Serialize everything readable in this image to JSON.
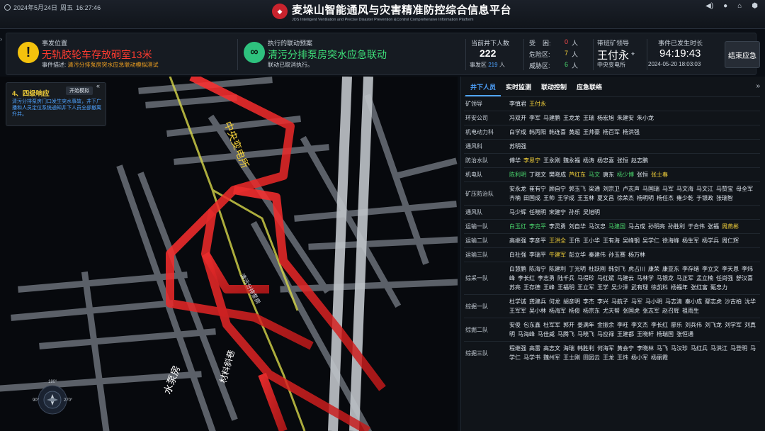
{
  "topbar": {
    "date": "2024年5月24日",
    "weekday": "周五",
    "time": "16:27:46",
    "title": "麦垛山智能通风与灾害精准防控综合信息平台",
    "subtitle": "JDS Intelligent Ventilation and Precise Disaster Prevention &Control Comprehensive Information Platform",
    "icons": [
      "speaker-icon",
      "user-icon",
      "home-icon",
      "cube-icon"
    ]
  },
  "incident": {
    "location_label": "事发位置",
    "location": "无轨胶轮车存放硐室13米",
    "desc_label": "事件描述:",
    "desc": "清污分排泵房突水应急联动模拟测试",
    "plan_label": "执行的联动预案",
    "plan": "清污分排泵房突水应急联动",
    "plan_status": "联动已取消执行。",
    "people_label": "当前井下人数",
    "people_count": "222",
    "area_label": "事发区",
    "area_count": "219",
    "area_unit": "人",
    "trapped_label": "受    困:",
    "trapped": "0",
    "danger_label": "危险区:",
    "danger": "7",
    "threat_label": "威胁区:",
    "threat": "6",
    "unit": "人",
    "leader_label": "带班矿领导",
    "leader": "王付永",
    "leader_loc": "中央变电所",
    "duration_label": "事件已发生时长",
    "duration": "94:19:43",
    "start_time": "2024-05-20 18:03:03",
    "end_button": "结束应急"
  },
  "response": {
    "title": "4、四级响应",
    "sim_button": "开始模拟",
    "text": "清污分排泵房门口发生突水事故，井下广播和人员定位系统通知井下人员全部撤离升井。"
  },
  "compass": {
    "n": "180°",
    "w": "90°",
    "e": "270°"
  },
  "map_labels": [
    "中央变电所",
    "清污分排泵房",
    "水泵房",
    "材料斜巷"
  ],
  "panel": {
    "tabs": [
      "井下人员",
      "实时监测",
      "联动控制",
      "应急联络"
    ],
    "roster": [
      {
        "team": "矿领导",
        "people": [
          [
            "李慎君",
            ""
          ],
          [
            "王付永",
            "yellow"
          ]
        ]
      },
      {
        "team": "环安公司",
        "people": [
          [
            "冯双开",
            ""
          ],
          [
            "李军",
            ""
          ],
          [
            "马建鹏",
            ""
          ],
          [
            "王龙龙",
            ""
          ],
          [
            "王瑞",
            ""
          ],
          [
            "杨宏旭",
            ""
          ],
          [
            "朱建安",
            ""
          ],
          [
            "朱小龙",
            ""
          ]
        ]
      },
      {
        "team": "机电动力科",
        "people": [
          [
            "白学成",
            ""
          ],
          [
            "韩丙阳",
            ""
          ],
          [
            "韩连喜",
            ""
          ],
          [
            "黄超",
            ""
          ],
          [
            "王帅豪",
            ""
          ],
          [
            "杨百军",
            ""
          ],
          [
            "杨洪强",
            ""
          ]
        ]
      },
      {
        "team": "通风科",
        "people": [
          [
            "苏明强",
            ""
          ]
        ]
      },
      {
        "team": "防治水队",
        "people": [
          [
            "傅华",
            ""
          ],
          [
            "李思宁",
            "yellow"
          ],
          [
            "王永刚",
            ""
          ],
          [
            "魏永福",
            ""
          ],
          [
            "杨涛",
            ""
          ],
          [
            "杨忠喜",
            ""
          ],
          [
            "张恒",
            ""
          ],
          [
            "赵志鹏",
            ""
          ]
        ]
      },
      {
        "team": "机电队",
        "people": [
          [
            "陈利明",
            "green"
          ],
          [
            "丁晓文",
            ""
          ],
          [
            "樊晓成",
            ""
          ],
          [
            "芦红东",
            "yellow"
          ],
          [
            "马文",
            "green"
          ],
          [
            "唐东",
            ""
          ],
          [
            "杨少博",
            "green"
          ],
          [
            "张恒",
            ""
          ],
          [
            "张士春",
            "yellow"
          ]
        ]
      },
      {
        "team": "矿压防治队",
        "people": [
          [
            "安永龙",
            ""
          ],
          [
            "崔有宁",
            ""
          ],
          [
            "顾自宁",
            ""
          ],
          [
            "郭玉飞",
            ""
          ],
          [
            "梁通",
            ""
          ],
          [
            "刘宗卫",
            ""
          ],
          [
            "卢志声",
            ""
          ],
          [
            "马国瑞",
            ""
          ],
          [
            "马军",
            ""
          ],
          [
            "马文海",
            ""
          ],
          [
            "马文江",
            ""
          ],
          [
            "马赞宝",
            ""
          ],
          [
            "母全军",
            ""
          ],
          [
            "齐楠",
            ""
          ],
          [
            "田国成",
            ""
          ],
          [
            "王帅",
            ""
          ],
          [
            "王学成",
            ""
          ],
          [
            "王玉林",
            ""
          ],
          [
            "夏文昌",
            ""
          ],
          [
            "徐荣杰",
            ""
          ],
          [
            "杨明明",
            ""
          ],
          [
            "杨任杰",
            ""
          ],
          [
            "雍少乾",
            ""
          ],
          [
            "于银政",
            ""
          ],
          [
            "张瑞智",
            ""
          ]
        ]
      },
      {
        "team": "通风队",
        "people": [
          [
            "马少辉",
            ""
          ],
          [
            "任晓明",
            ""
          ],
          [
            "宋建宁",
            ""
          ],
          [
            "孙乐",
            ""
          ],
          [
            "吴旭明",
            ""
          ]
        ]
      },
      {
        "team": "运输一队",
        "people": [
          [
            "白玉红",
            "green"
          ],
          [
            "李克平",
            "green"
          ],
          [
            "李灵勇",
            ""
          ],
          [
            "刘自华",
            ""
          ],
          [
            "马汉忠",
            ""
          ],
          [
            "马建国",
            "green"
          ],
          [
            "马占成",
            ""
          ],
          [
            "孙明亮",
            ""
          ],
          [
            "孙胜利",
            ""
          ],
          [
            "于合伟",
            ""
          ],
          [
            "张福",
            ""
          ],
          [
            "周燕彬",
            "yellow"
          ]
        ]
      },
      {
        "team": "运输二队",
        "people": [
          [
            "高继强",
            ""
          ],
          [
            "李彦平",
            ""
          ],
          [
            "王洪全",
            "yellow"
          ],
          [
            "王伟",
            ""
          ],
          [
            "王小华",
            ""
          ],
          [
            "王有海",
            ""
          ],
          [
            "吴峰钢",
            ""
          ],
          [
            "吴学仁",
            ""
          ],
          [
            "徐海峰",
            ""
          ],
          [
            "杨生军",
            ""
          ],
          [
            "杨学兵",
            ""
          ],
          [
            "周仁辉",
            ""
          ]
        ]
      },
      {
        "team": "运输三队",
        "people": [
          [
            "白社强",
            ""
          ],
          [
            "李瑞平",
            ""
          ],
          [
            "牛建军",
            "yellow"
          ],
          [
            "彭立华",
            ""
          ],
          [
            "秦建伟",
            ""
          ],
          [
            "孙玉赛",
            ""
          ],
          [
            "杨万林",
            ""
          ]
        ]
      },
      {
        "team": "综采一队",
        "people": [
          [
            "白慧鹏",
            ""
          ],
          [
            "陈海宁",
            ""
          ],
          [
            "陈建利",
            ""
          ],
          [
            "丁光明",
            ""
          ],
          [
            "杜跃刚",
            ""
          ],
          [
            "韩剑飞",
            ""
          ],
          [
            "虎占川",
            ""
          ],
          [
            "康荣",
            ""
          ],
          [
            "康亚东",
            ""
          ],
          [
            "李存绪",
            ""
          ],
          [
            "李立文",
            ""
          ],
          [
            "李天恩",
            ""
          ],
          [
            "李炜峰",
            ""
          ],
          [
            "李长红",
            ""
          ],
          [
            "李志勇",
            ""
          ],
          [
            "陆千兵",
            ""
          ],
          [
            "马得珍",
            ""
          ],
          [
            "马红斌",
            ""
          ],
          [
            "马建云",
            ""
          ],
          [
            "马林学",
            ""
          ],
          [
            "马银龙",
            ""
          ],
          [
            "马正军",
            ""
          ],
          [
            "孟立楠",
            ""
          ],
          [
            "任尚强",
            ""
          ],
          [
            "舒汉喜",
            ""
          ],
          [
            "苏亮",
            ""
          ],
          [
            "王存德",
            ""
          ],
          [
            "王峰",
            ""
          ],
          [
            "王福明",
            ""
          ],
          [
            "王立军",
            ""
          ],
          [
            "王学",
            ""
          ],
          [
            "吴少泽",
            ""
          ],
          [
            "武有理",
            ""
          ],
          [
            "徐凯科",
            ""
          ],
          [
            "杨福年",
            ""
          ],
          [
            "张红富",
            ""
          ],
          [
            "甄忠力",
            ""
          ]
        ]
      },
      {
        "team": "综掘一队",
        "people": [
          [
            "杜学诚",
            ""
          ],
          [
            "龚建兵",
            ""
          ],
          [
            "何龙",
            ""
          ],
          [
            "胡彦明",
            ""
          ],
          [
            "李杰",
            ""
          ],
          [
            "李兴",
            ""
          ],
          [
            "马航子",
            ""
          ],
          [
            "马军",
            ""
          ],
          [
            "马小明",
            ""
          ],
          [
            "马志清",
            ""
          ],
          [
            "秦小成",
            ""
          ],
          [
            "鄢志虎",
            ""
          ],
          [
            "沙古柏",
            ""
          ],
          [
            "沈华",
            ""
          ],
          [
            "王军军",
            ""
          ],
          [
            "吴小林",
            ""
          ],
          [
            "杨海军",
            ""
          ],
          [
            "杨俊",
            ""
          ],
          [
            "杨宗东",
            ""
          ],
          [
            "尤天帮",
            ""
          ],
          [
            "张国虎",
            ""
          ],
          [
            "张志军",
            ""
          ],
          [
            "赵召辉",
            ""
          ],
          [
            "祖雨生",
            ""
          ]
        ]
      },
      {
        "team": "综掘二队",
        "people": [
          [
            "安俊",
            ""
          ],
          [
            "包东鑫",
            ""
          ],
          [
            "杜军军",
            ""
          ],
          [
            "郭开",
            ""
          ],
          [
            "姜满年",
            ""
          ],
          [
            "金振余",
            ""
          ],
          [
            "李旺",
            ""
          ],
          [
            "李文杰",
            ""
          ],
          [
            "李长红",
            ""
          ],
          [
            "廖乐",
            ""
          ],
          [
            "刘兵伟",
            ""
          ],
          [
            "刘飞龙",
            ""
          ],
          [
            "刘学军",
            ""
          ],
          [
            "刘真明",
            ""
          ],
          [
            "马海峰",
            ""
          ],
          [
            "马佳威",
            ""
          ],
          [
            "马腾飞",
            ""
          ],
          [
            "马晓飞",
            ""
          ],
          [
            "马应禄",
            ""
          ],
          [
            "王建都",
            ""
          ],
          [
            "王晓轩",
            ""
          ],
          [
            "杨瑞国",
            ""
          ],
          [
            "张恒通",
            ""
          ]
        ]
      },
      {
        "team": "综掘三队",
        "people": [
          [
            "程继强",
            ""
          ],
          [
            "高雷",
            ""
          ],
          [
            "高志文",
            ""
          ],
          [
            "海瑞",
            ""
          ],
          [
            "韩胜利",
            ""
          ],
          [
            "何海军",
            ""
          ],
          [
            "黄会宁",
            ""
          ],
          [
            "李晓林",
            ""
          ],
          [
            "马飞",
            ""
          ],
          [
            "马汉珍",
            ""
          ],
          [
            "马红兵",
            ""
          ],
          [
            "马洪江",
            ""
          ],
          [
            "马登明",
            ""
          ],
          [
            "马学仁",
            ""
          ],
          [
            "马学书",
            ""
          ],
          [
            "魏州军",
            ""
          ],
          [
            "王士刚",
            ""
          ],
          [
            "田园云",
            ""
          ],
          [
            "王龙",
            ""
          ],
          [
            "王炜",
            ""
          ],
          [
            "杨小军",
            ""
          ],
          [
            "杨丽霞",
            ""
          ]
        ]
      }
    ]
  }
}
